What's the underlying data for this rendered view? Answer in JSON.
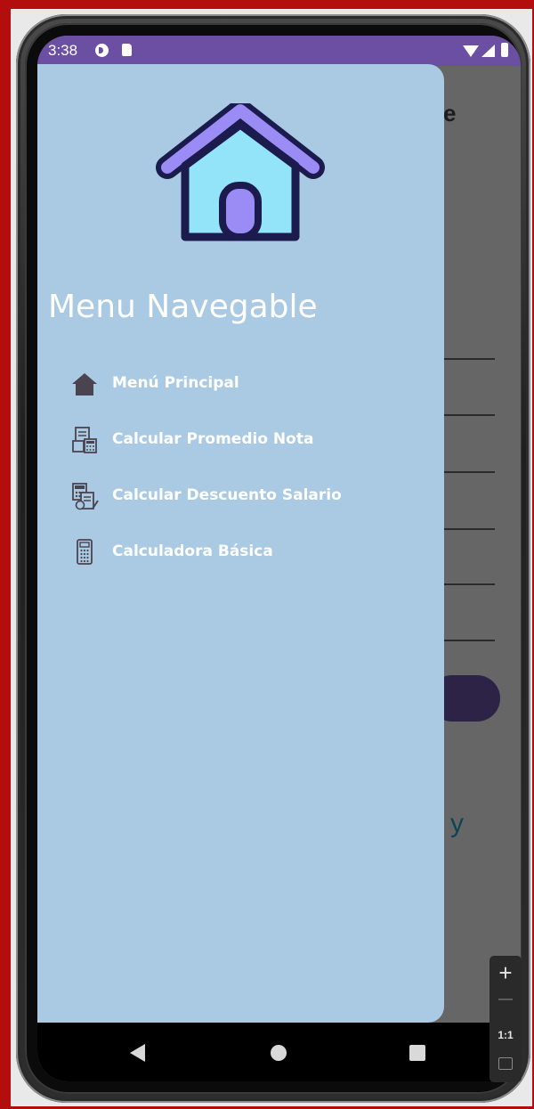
{
  "status_bar": {
    "time": "3:38",
    "icons": [
      "data-saver-icon",
      "sd-card-icon",
      "wifi-icon",
      "signal-icon",
      "battery-icon"
    ],
    "bg_color": "#6a4fa3"
  },
  "background_app": {
    "title_fragment": "e",
    "bottom_fragment": "y",
    "button_color": "#2d2346"
  },
  "drawer": {
    "bg_color": "#a9cae2",
    "header_icon": "house-icon",
    "title": "Menu Navegable",
    "items": [
      {
        "label": "Menú Principal",
        "icon": "home-icon"
      },
      {
        "label": "Calcular Promedio Nota",
        "icon": "calculator-document-icon"
      },
      {
        "label": "Calcular Descuento Salario",
        "icon": "salary-discount-icon"
      },
      {
        "label": "Calculadora Básica",
        "icon": "calculator-icon"
      }
    ]
  },
  "nav_bar": {
    "icons": [
      "back-icon",
      "home-circle-icon",
      "recents-icon"
    ]
  },
  "emulator_controls": {
    "zoom_in": "+",
    "zoom_out": "—",
    "actual_size": "1:1"
  }
}
